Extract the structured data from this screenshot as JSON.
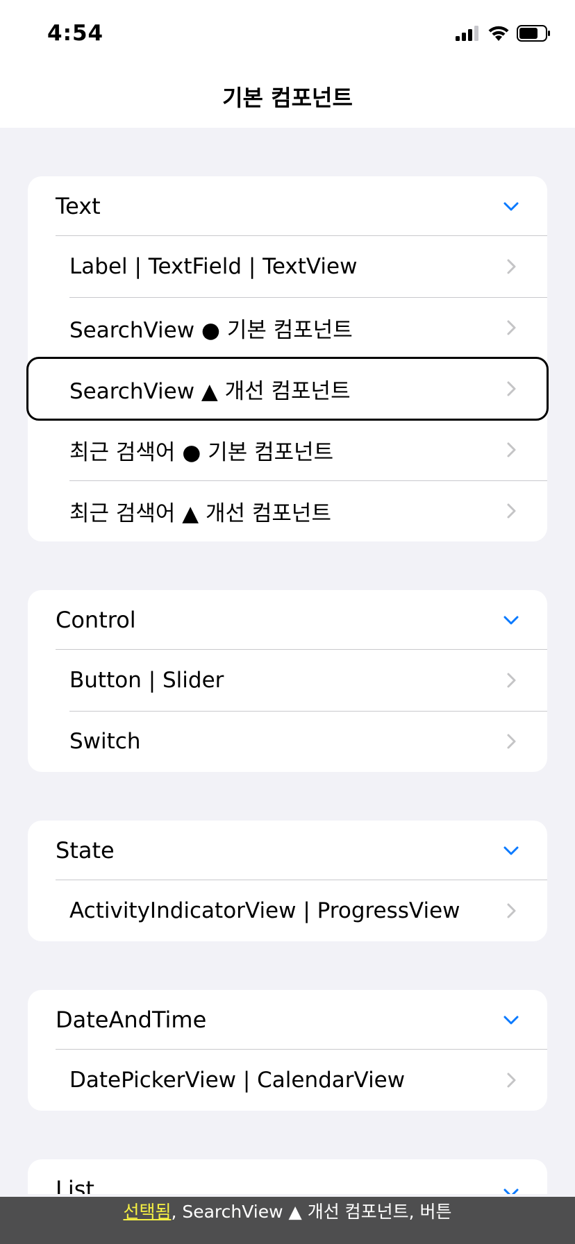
{
  "status": {
    "time": "4:54"
  },
  "nav": {
    "title": "기본 컴포넌트"
  },
  "colors": {
    "accent": "#0a7aff",
    "chevron": "#c4c4c6"
  },
  "sections": [
    {
      "title": "Text",
      "rows": [
        "Label | TextField | TextView",
        "SearchView ● 기본 컴포넌트",
        "SearchView ▲ 개선 컴포넌트",
        "최근 검색어 ● 기본 컴포넌트",
        "최근 검색어 ▲ 개선 컴포넌트"
      ]
    },
    {
      "title": "Control",
      "rows": [
        "Button | Slider",
        "Switch"
      ]
    },
    {
      "title": "State",
      "rows": [
        "ActivityIndicatorView | ProgressView"
      ]
    },
    {
      "title": "DateAndTime",
      "rows": [
        "DatePickerView | CalendarView"
      ]
    },
    {
      "title": "List",
      "rows": []
    }
  ],
  "voiceover": {
    "highlight": "선택됨",
    "rest": ", SearchView ▲ 개선 컴포넌트, 버튼"
  }
}
